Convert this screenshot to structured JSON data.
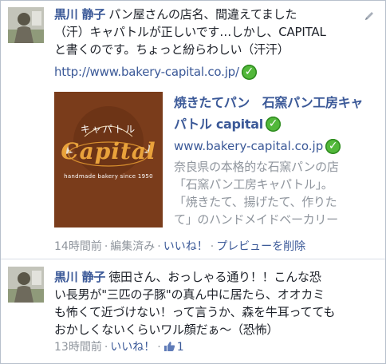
{
  "comments": [
    {
      "author": "黒川 静子",
      "text_lines": [
        "パン屋さんの店名、間違えてました",
        "（汗）キャパトルが正しいです…しかし、CAPITAL",
        "と書くのです。ちょっと紛らわしい（汗汗）"
      ],
      "url": "http://www.bakery-capital.co.jp/",
      "preview": {
        "title_lines": [
          "焼きたてパン　石窯パン工房キャ",
          "パトル capital"
        ],
        "domain": "www.bakery-capital.co.jp",
        "description_lines": [
          "奈良県の本格的な石窯パンの店",
          "「石窯パン工房キャパトル」。",
          "「焼きたて、揚げたて、作りた",
          "て」のハンドメイドベーカリー"
        ],
        "logo_text": "Capital",
        "logo_kana": "キャパトル",
        "logo_tagline": "handmade bakery since 1950"
      },
      "meta": {
        "time": "14時間前",
        "edited": "編集済み",
        "like": "いいね！",
        "remove_preview": "プレビューを削除"
      }
    },
    {
      "author": "黒川 静子",
      "text_lines": [
        "徳田さん、おっしゃる通り！！こんな恐",
        "い長男が\"三匹の子豚\"の真ん中に居たら、オオカミ",
        "も怖くて近づけない！って言うか、森を牛耳ってても",
        "おかしくないくらいワル顔だぁ～（恐怖）"
      ],
      "meta": {
        "time": "13時間前",
        "like": "いいね！",
        "like_count": "1"
      }
    }
  ],
  "colors": {
    "link": "#3b5998",
    "meta_gray": "#8f959d",
    "check_green": "#52b83a",
    "logo_bg": "#7a3c1b"
  }
}
